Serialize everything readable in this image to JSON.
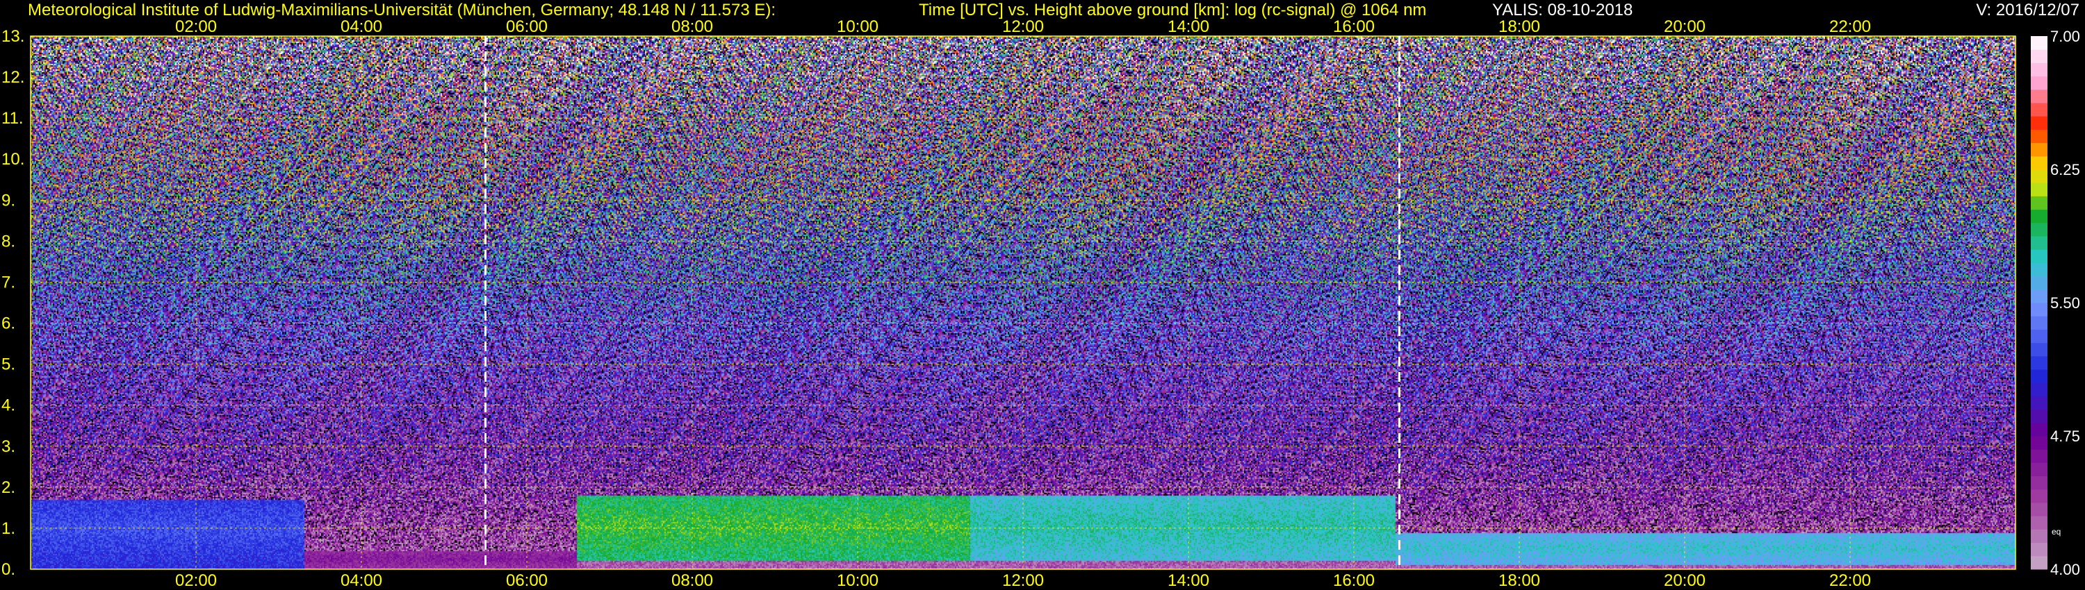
{
  "header": {
    "institute": "Meteorological Institute of Ludwig-Maximilians-Universität (München, Germany; 48.148 N / 11.573 E):",
    "description": "Time [UTC] vs. Height above ground [km]: log (rc-signal) @ 1064 nm",
    "instrument_date": "YALIS: 08-10-2018",
    "version": "V: 2016/12/07"
  },
  "colors": {
    "header_text": "#ffff00",
    "version_text": "#ffffff",
    "axis_text": "#ffff00",
    "grid": "#ffff00",
    "marker": "#ffffff",
    "colorbar_label": "#ffffff"
  },
  "chart_data": {
    "type": "heatmap",
    "title": "Time [UTC] vs. Height above ground [km]: log (rc-signal) @ 1064 nm",
    "xlabel": "Time [UTC]",
    "ylabel": "Height above ground [km]",
    "x_range_hours": [
      0.0,
      24.0
    ],
    "y_range_km": [
      0,
      13
    ],
    "x_ticks": [
      "02:00",
      "04:00",
      "06:00",
      "08:00",
      "10:00",
      "12:00",
      "14:00",
      "16:00",
      "18:00",
      "20:00",
      "22:00"
    ],
    "x_tick_hours": [
      2,
      4,
      6,
      8,
      10,
      12,
      14,
      16,
      18,
      20,
      22
    ],
    "y_ticks": [
      "0.",
      "1.",
      "2.",
      "3.",
      "4.",
      "5.",
      "6.",
      "7.",
      "8.",
      "9.",
      "10.",
      "11.",
      "12.",
      "13."
    ],
    "y_tick_values": [
      0,
      1,
      2,
      3,
      4,
      5,
      6,
      7,
      8,
      9,
      10,
      11,
      12,
      13
    ],
    "grid": true,
    "markers_hours": [
      5.5,
      16.55
    ],
    "colorbar": {
      "range": [
        4.0,
        7.0
      ],
      "ticks": [
        "4.00",
        "4.75",
        "5.50",
        "6.25",
        "7.00"
      ],
      "tick_values": [
        4.0,
        4.75,
        5.5,
        6.25,
        7.0
      ],
      "extra_label": "eq"
    },
    "features": [
      {
        "start_h": 0.0,
        "end_h": 3.3,
        "layer_top_km": 1.7,
        "level": 5.25
      },
      {
        "start_h": 3.3,
        "end_h": 6.6,
        "layer_top_km": 0.45,
        "level": 4.6
      },
      {
        "start_h": 6.6,
        "end_h": 11.35,
        "layer_top_km": 1.8,
        "level": 6.0
      },
      {
        "start_h": 11.35,
        "end_h": 16.5,
        "layer_top_km": 1.8,
        "level": 5.8
      },
      {
        "start_h": 16.5,
        "end_h": 24.0,
        "layer_top_km": 0.9,
        "level": 5.7
      }
    ]
  }
}
